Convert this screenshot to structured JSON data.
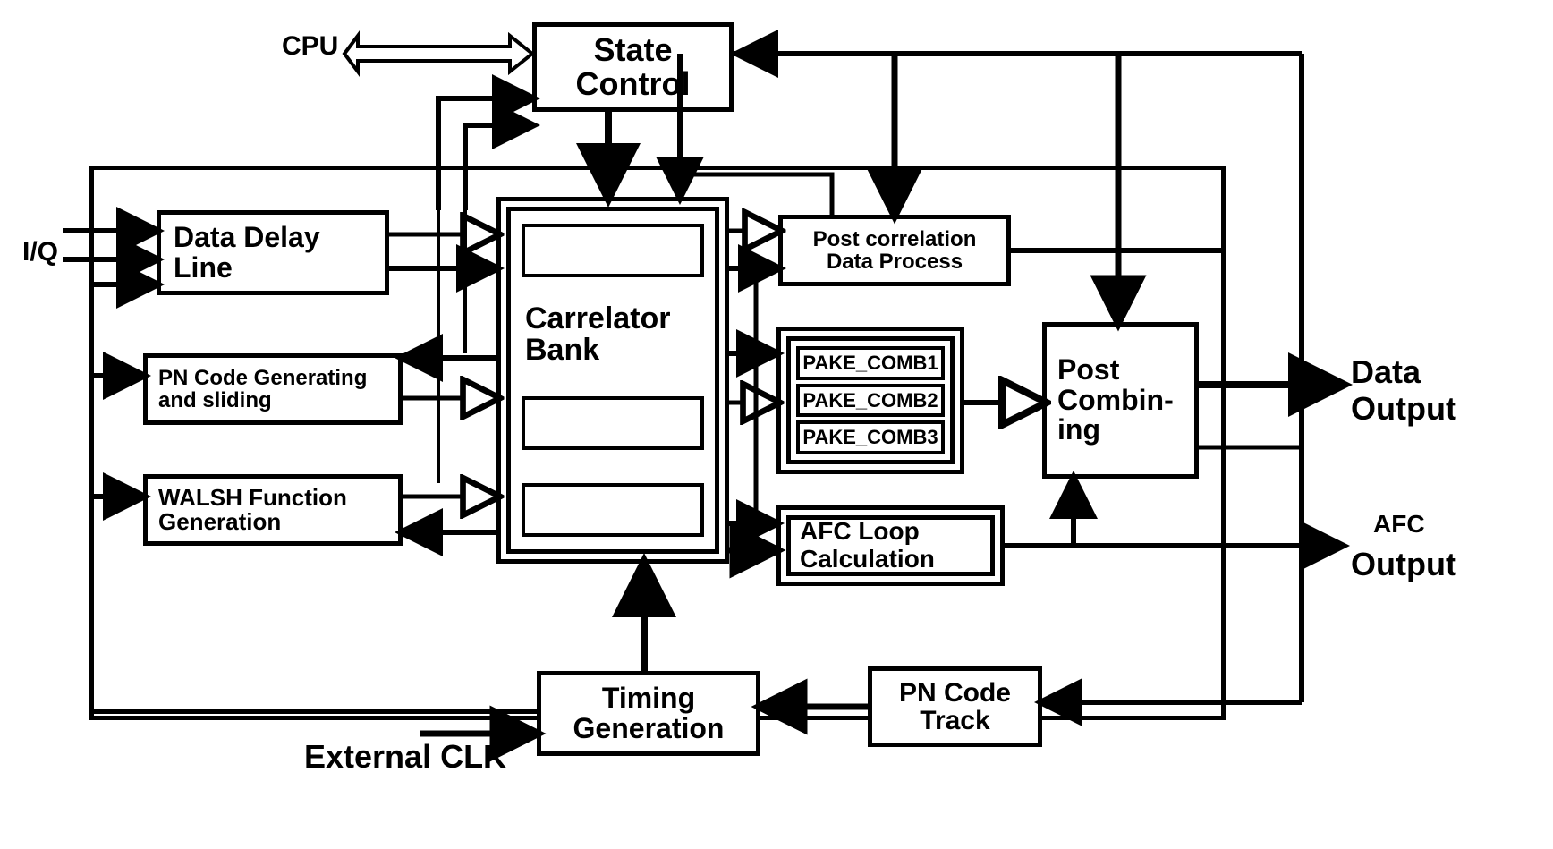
{
  "labels": {
    "cpu": "CPU",
    "iq": "I/Q",
    "external_clk": "External CLK",
    "data_output": "Data\nOutput",
    "afc_output_tag": "AFC",
    "afc_output": "Output"
  },
  "blocks": {
    "state_control": "State\nControl",
    "data_delay_line": "Data Delay\nLine",
    "pn_code_gen": "PN Code Generating\nand sliding",
    "walsh": "WALSH Function\nGeneration",
    "correlator_bank": "Carrelator\nBank",
    "post_corr": "Post correlation\nData Process",
    "pake1": "PAKE_COMB1",
    "pake2": "PAKE_COMB2",
    "pake3": "PAKE_COMB3",
    "afc_loop": "AFC Loop\nCalculation",
    "post_combining": "Post\nCombin-\ning",
    "timing_gen": "Timing\nGeneration",
    "pn_track": "PN Code\nTrack"
  }
}
